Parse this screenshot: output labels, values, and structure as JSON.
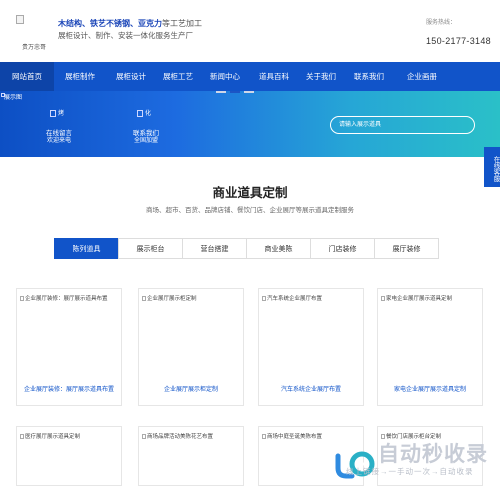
{
  "header": {
    "logo_alt": "贵万忠哥",
    "tagline_blue": "木结构、铁艺不锈钢、亚克力",
    "tagline_gray": "等工艺加工",
    "tagline_line2": "展柜设计、制作、安装一体化服务生产厂",
    "hotline_label": "服务热线：",
    "hotline_number": "150-2177-3148"
  },
  "nav": {
    "items": [
      "网站首页",
      "展柜制作",
      "展柜设计",
      "展柜工艺",
      "新闻中心",
      "道具百科",
      "关于我们",
      "联系我们",
      "企业画册"
    ]
  },
  "banner": {
    "alt": "展示图",
    "features": [
      {
        "mark": "烤",
        "title": "在线留言",
        "sub": "欢迎来电"
      },
      {
        "mark": "化",
        "title": "联系我们",
        "sub": "全国加盟"
      }
    ],
    "search_placeholder": "请输入展示道具"
  },
  "side_tab": {
    "label": "在线客服"
  },
  "section": {
    "title": "商业道具定制",
    "subtitle": "商场、超市、百货、品牌店铺、餐饮门店、企业展厅等展示道具定制服务",
    "tabs": [
      "陈列道具",
      "展示柜台",
      "营台搭建",
      "商业美陈",
      "门店装修",
      "展厅装修"
    ]
  },
  "cards_row1": [
    {
      "alt": "企业展厅装修：展厅展示道具布置",
      "caption": "企业展厅装修：展厅展示道具布置"
    },
    {
      "alt": "企业展厅展示柜定制",
      "caption": "企业展厅展示柜定制"
    },
    {
      "alt": "汽车系统企业展厅布置",
      "caption": "汽车系统企业展厅布置"
    },
    {
      "alt": "家电企业展厅展示道具定制",
      "caption": "家电企业展厅展示道具定制"
    }
  ],
  "cards_row2": [
    {
      "alt": "医疗展厅展示道具定制"
    },
    {
      "alt": "商场品牌活动美陈花艺布置"
    },
    {
      "alt": "商场中庭圣诞美陈布置"
    },
    {
      "alt": "餐饮门店展示柜台定制"
    }
  ],
  "watermark": {
    "name": "自动秒收录",
    "slogan": "线上链接→一手动一次→自动收录"
  },
  "colors": {
    "primary": "#1154c9",
    "nav_active": "#0d44a8"
  }
}
